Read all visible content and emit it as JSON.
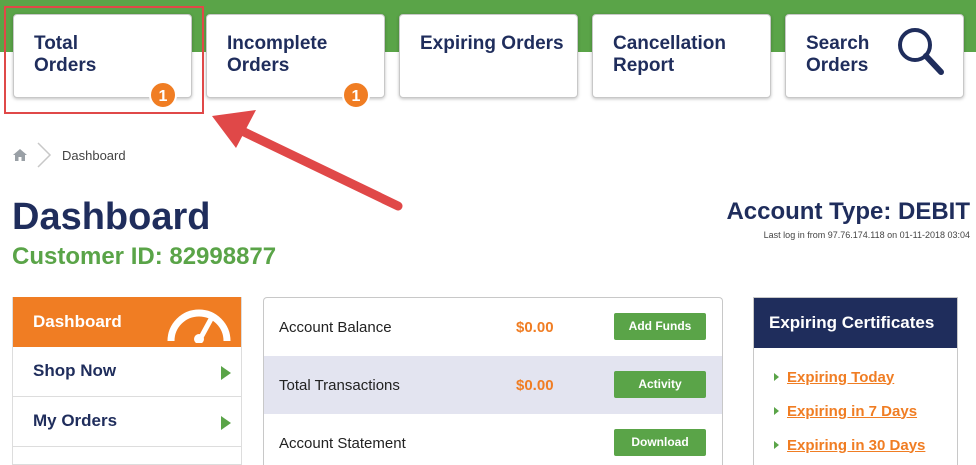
{
  "top_nav": {
    "tiles": [
      {
        "label": "Total\nOrders",
        "badge": "1"
      },
      {
        "label": "Incomplete\nOrders",
        "badge": "1"
      },
      {
        "label": "Expiring Orders"
      },
      {
        "label": "Cancellation\nReport"
      },
      {
        "label": "Search\nOrders",
        "icon": "magnifier-icon"
      }
    ]
  },
  "breadcrumb": {
    "home_icon": "home-icon",
    "current": "Dashboard"
  },
  "header": {
    "title": "Dashboard",
    "customer_id": "Customer ID: 82998877",
    "account_type": "Account Type: DEBIT",
    "last_log": "Last log in from 97.76.174.118 on 01-11-2018 03:04"
  },
  "side_menu": {
    "header": "Dashboard",
    "header_icon": "gauge-icon",
    "items": [
      {
        "label": "Shop Now"
      },
      {
        "label": "My Orders"
      }
    ]
  },
  "account": {
    "rows": [
      {
        "label": "Account Balance",
        "value": "$0.00",
        "button": "Add Funds"
      },
      {
        "label": "Total Transactions",
        "value": "$0.00",
        "button": "Activity"
      },
      {
        "label": "Account Statement",
        "value": "",
        "button": "Download"
      }
    ]
  },
  "expiring": {
    "title": "Expiring Certificates",
    "links": [
      "Expiring Today",
      "Expiring in 7 Days",
      "Expiring in 30 Days"
    ]
  },
  "colors": {
    "brand_green": "#5aa448",
    "navy": "#1f2d5c",
    "orange": "#f07d23",
    "annotation_red": "#e04848"
  }
}
